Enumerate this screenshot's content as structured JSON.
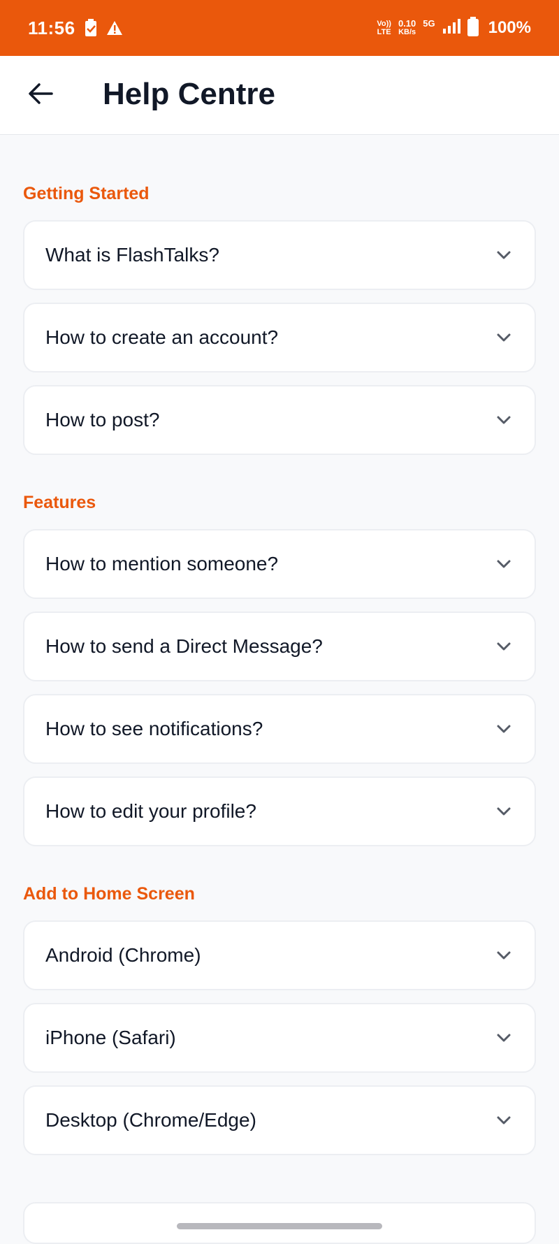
{
  "status_bar": {
    "time": "11:56",
    "network_top": "Vo))",
    "network_bottom": "LTE",
    "speed_value": "0.10",
    "speed_unit": "KB/s",
    "net_type": "5G",
    "battery": "100%"
  },
  "header": {
    "title": "Help Centre",
    "back_icon": "arrow-left-icon"
  },
  "sections": [
    {
      "heading": "Getting Started",
      "items": [
        {
          "question": "What is FlashTalks?"
        },
        {
          "question": "How to create an account?"
        },
        {
          "question": "How to post?"
        }
      ]
    },
    {
      "heading": "Features",
      "items": [
        {
          "question": "How to mention someone?"
        },
        {
          "question": "How to send a Direct Message?"
        },
        {
          "question": "How to see notifications?"
        },
        {
          "question": "How to edit your profile?"
        }
      ]
    },
    {
      "heading": "Add to Home Screen",
      "items": [
        {
          "question": "Android (Chrome)"
        },
        {
          "question": "iPhone (Safari)"
        },
        {
          "question": "Desktop (Chrome/Edge)"
        }
      ]
    }
  ],
  "colors": {
    "accent": "#ea580c",
    "background": "#f8f9fb",
    "card": "#ffffff",
    "text": "#111827"
  }
}
